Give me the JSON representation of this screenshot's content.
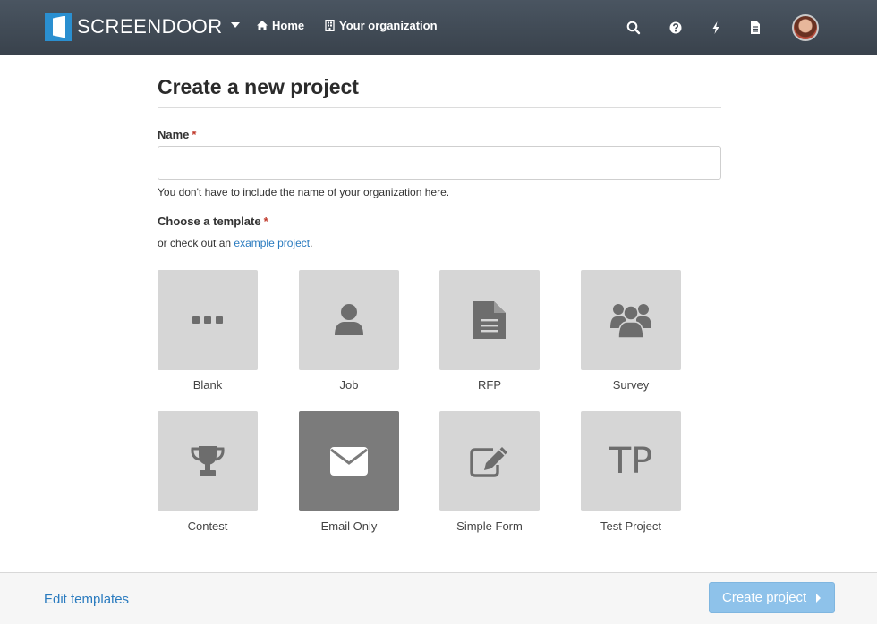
{
  "header": {
    "brand": "SCREENDOOR",
    "nav": [
      {
        "label": "Home",
        "icon": "home-icon"
      },
      {
        "label": "Your organization",
        "icon": "building-icon"
      }
    ],
    "icons": [
      "search-icon",
      "help-icon",
      "bolt-icon",
      "document-icon"
    ]
  },
  "main": {
    "title": "Create a new project",
    "name_label": "Name",
    "required_mark": "*",
    "name_value": "",
    "name_help": "You don't have to include the name of your organization here.",
    "template_label": "Choose a template",
    "template_help_prefix": "or check out an ",
    "template_help_link": "example project",
    "template_help_suffix": ".",
    "templates": [
      {
        "label": "Blank",
        "icon": "ellipsis-icon",
        "selected": false
      },
      {
        "label": "Job",
        "icon": "user-icon",
        "selected": false
      },
      {
        "label": "RFP",
        "icon": "file-text-icon",
        "selected": false
      },
      {
        "label": "Survey",
        "icon": "users-icon",
        "selected": false
      },
      {
        "label": "Contest",
        "icon": "trophy-icon",
        "selected": false
      },
      {
        "label": "Email Only",
        "icon": "envelope-icon",
        "selected": true
      },
      {
        "label": "Simple Form",
        "icon": "edit-icon",
        "selected": false
      },
      {
        "label": "Test Project",
        "icon_text": "TP",
        "selected": false
      }
    ]
  },
  "footer": {
    "edit_templates": "Edit templates",
    "create_button": "Create project"
  },
  "colors": {
    "header_bg": "#3f4852",
    "brand_blue": "#2a8fd0",
    "link": "#2a7bbf",
    "tile_bg": "#d6d6d6",
    "tile_selected_bg": "#7b7b7b",
    "primary_button": "#8ec2ea",
    "required": "#c0392b"
  }
}
